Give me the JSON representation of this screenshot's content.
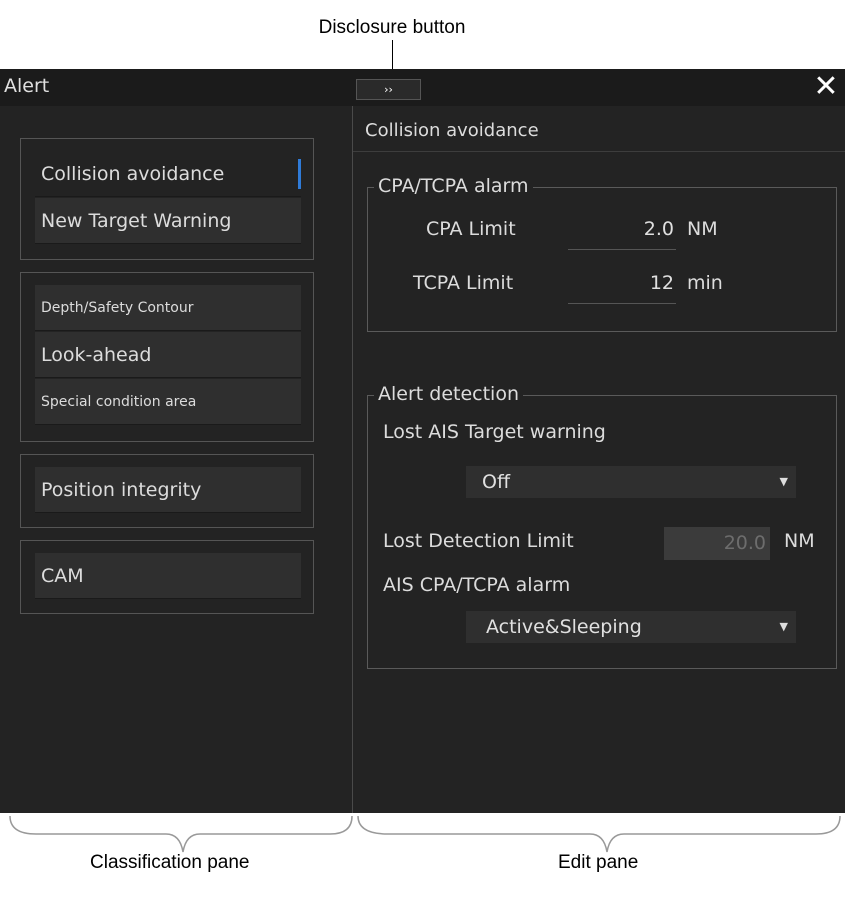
{
  "annotations": {
    "disclosure": "Disclosure button",
    "classification": "Classification pane",
    "edit": "Edit pane"
  },
  "window": {
    "title": "Alert",
    "disclosure_glyph": "››",
    "close_glyph": "✕"
  },
  "classification": {
    "group1": [
      "Collision avoidance",
      "New Target Warning"
    ],
    "group2": [
      "Depth/Safety Contour",
      "Look-ahead",
      "Special condition area"
    ],
    "group3": [
      "Position integrity"
    ],
    "group4": [
      "CAM"
    ],
    "selected_color": "#2f7bd8"
  },
  "edit": {
    "title": "Collision avoidance",
    "cpa_section": {
      "legend": "CPA/TCPA alarm",
      "cpa_label": "CPA Limit",
      "cpa_value": "2.0",
      "cpa_unit": "NM",
      "tcpa_label": "TCPA Limit",
      "tcpa_value": "12",
      "tcpa_unit": "min"
    },
    "detection_section": {
      "legend": "Alert detection",
      "lost_ais_label": "Lost AIS Target warning",
      "lost_ais_value": "Off",
      "lost_limit_label": "Lost Detection Limit",
      "lost_limit_value": "20.0",
      "lost_limit_unit": "NM",
      "ais_alarm_label": "AIS CPA/TCPA alarm",
      "ais_alarm_value": "Active&Sleeping"
    }
  }
}
